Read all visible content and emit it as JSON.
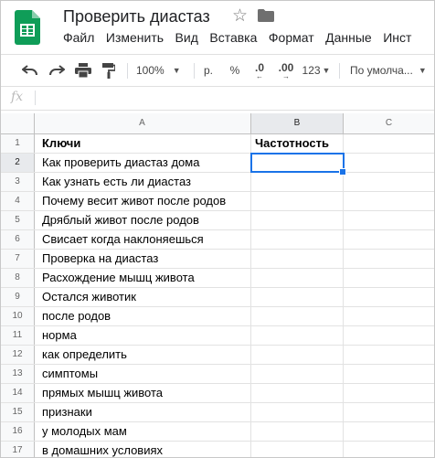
{
  "doc": {
    "title": "Проверить диастаз"
  },
  "menu": [
    "Файл",
    "Изменить",
    "Вид",
    "Вставка",
    "Формат",
    "Данные",
    "Инст"
  ],
  "toolbar": {
    "zoom": "100%",
    "currency": "р.",
    "percent": "%",
    "decrease_decimals": ".0",
    "increase_decimals": ".00",
    "number_format": "123",
    "font": "По умолча..."
  },
  "formula_bar": {
    "fx": "fx",
    "value": ""
  },
  "columns": [
    "A",
    "B",
    "C"
  ],
  "selected": {
    "row": 2,
    "col": "B"
  },
  "rows": [
    {
      "num": "1",
      "a": "Ключи",
      "b": "Частотность",
      "bold": true
    },
    {
      "num": "2",
      "a": "Как проверить диастаз дома",
      "b": ""
    },
    {
      "num": "3",
      "a": "Как узнать есть ли диастаз",
      "b": ""
    },
    {
      "num": "4",
      "a": "Почему весит живот после родов",
      "b": ""
    },
    {
      "num": "5",
      "a": "Дряблый живот после родов",
      "b": ""
    },
    {
      "num": "6",
      "a": "Свисает когда наклоняешься",
      "b": ""
    },
    {
      "num": "7",
      "a": "Проверка на диастаз",
      "b": ""
    },
    {
      "num": "8",
      "a": "Расхождение мышц живота",
      "b": ""
    },
    {
      "num": "9",
      "a": "Остался животик",
      "b": ""
    },
    {
      "num": "10",
      "a": "после родов",
      "b": ""
    },
    {
      "num": "11",
      "a": "норма",
      "b": ""
    },
    {
      "num": "12",
      "a": "как определить",
      "b": ""
    },
    {
      "num": "13",
      "a": "симптомы",
      "b": ""
    },
    {
      "num": "14",
      "a": "прямых мышц живота",
      "b": ""
    },
    {
      "num": "15",
      "a": "признаки",
      "b": ""
    },
    {
      "num": "16",
      "a": "у молодых мам",
      "b": ""
    },
    {
      "num": "17",
      "a": "в домашних условиях",
      "b": ""
    }
  ],
  "colors": {
    "sheets_green": "#0f9d58",
    "selection_blue": "#1a73e8"
  }
}
